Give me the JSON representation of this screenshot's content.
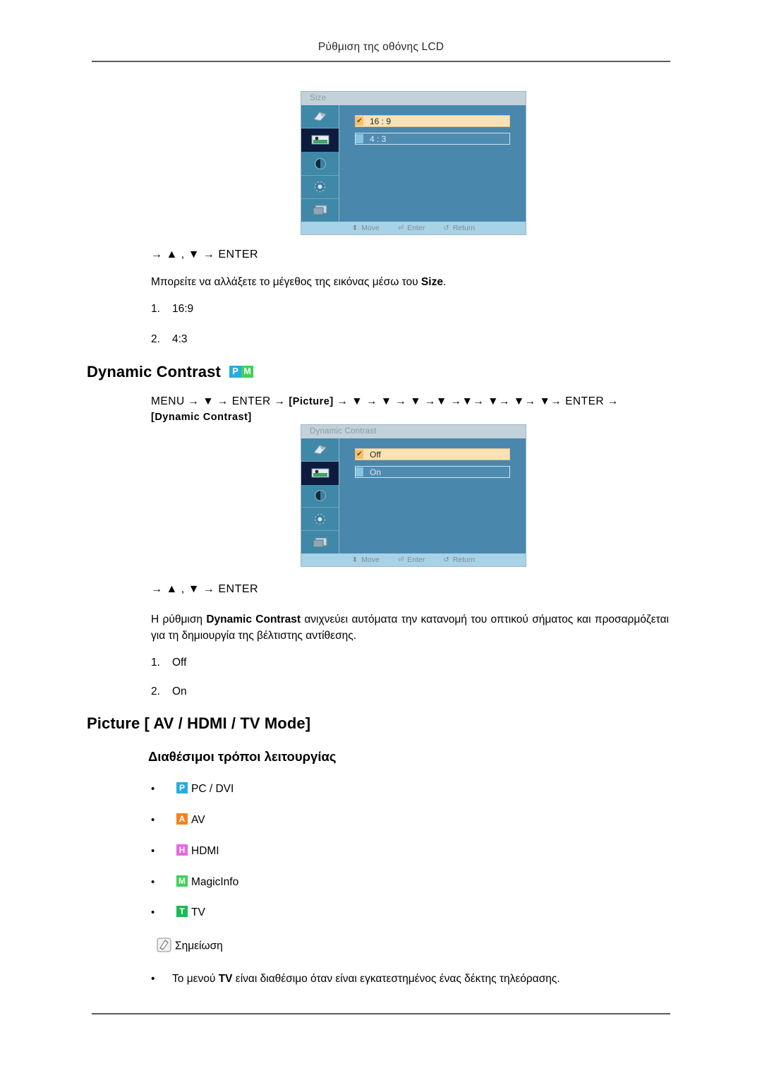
{
  "page": {
    "header_title": "Ρύθμιση της οθόνης LCD"
  },
  "size_section": {
    "osd": {
      "title": "Size",
      "rows": [
        {
          "label": "16 : 9",
          "selected": true
        },
        {
          "label": "4 : 3",
          "selected": false
        }
      ],
      "footer": {
        "move": "Move",
        "enter": "Enter",
        "return": "Return"
      }
    },
    "nav_line": "→ ▲ , ▼ → ENTER",
    "description": "Μπορείτε να αλλάξετε το μέγεθος της εικόνας μέσω του ",
    "description_bold": "Size",
    "description_end": ".",
    "items": [
      {
        "num": "1.",
        "label": "16:9"
      },
      {
        "num": "2.",
        "label": "4:3"
      }
    ]
  },
  "dynamic_contrast_section": {
    "heading": "Dynamic Contrast",
    "heading_badges": [
      {
        "letter": "P",
        "color": "#29abe2"
      },
      {
        "letter": "M",
        "color": "#3fd157"
      }
    ],
    "menu_path_1": "MENU  →  ▼  →  ENTER  →  ",
    "menu_path_bracket_1": "[Picture]",
    "menu_path_2": "  →  ▼  →  ▼  →  ▼  →▼  →▼→  ▼→  ▼→  ▼→  ENTER  →",
    "menu_path_bracket_2": "[Dynamic Contrast]",
    "osd": {
      "title": "Dynamic Contrast",
      "rows": [
        {
          "label": "Off",
          "selected": true
        },
        {
          "label": "On",
          "selected": false
        }
      ],
      "footer": {
        "move": "Move",
        "enter": "Enter",
        "return": "Return"
      }
    },
    "nav_line": "→ ▲ , ▼ → ENTER",
    "paragraph_start": "Η ρύθμιση ",
    "paragraph_bold": "Dynamic Contrast",
    "paragraph_end": " ανιχνεύει αυτόματα την κατανομή του οπτικού σήματος και προσαρμόζεται για τη δημιουργία της βέλτιστης αντίθεσης.",
    "items": [
      {
        "num": "1.",
        "label": "Off"
      },
      {
        "num": "2.",
        "label": "On"
      }
    ]
  },
  "picture_section": {
    "heading": "Picture [ AV / HDMI / TV Mode]",
    "subheading": "Διαθέσιμοι τρόποι λειτουργίας",
    "modes": [
      {
        "bullet": "•",
        "badge": "P",
        "color": "#29abe2",
        "label": "PC / DVI"
      },
      {
        "bullet": "•",
        "badge": "A",
        "color": "#f5821f",
        "label": "AV"
      },
      {
        "bullet": "•",
        "badge": "H",
        "color": "#e36ae0",
        "label": "HDMI"
      },
      {
        "bullet": "•",
        "badge": "M",
        "color": "#3fd157",
        "label": "MagicInfo"
      },
      {
        "bullet": "•",
        "badge": "T",
        "color": "#1db954",
        "label": "TV"
      }
    ],
    "note_label": "Σημείωση",
    "note_bullet": "•",
    "note_text_start": "Το μενού ",
    "note_text_bold": "TV",
    "note_text_end": " είναι διαθέσιμο όταν είναι εγκατεστημένος ένας δέκτης τηλεόρασης."
  }
}
